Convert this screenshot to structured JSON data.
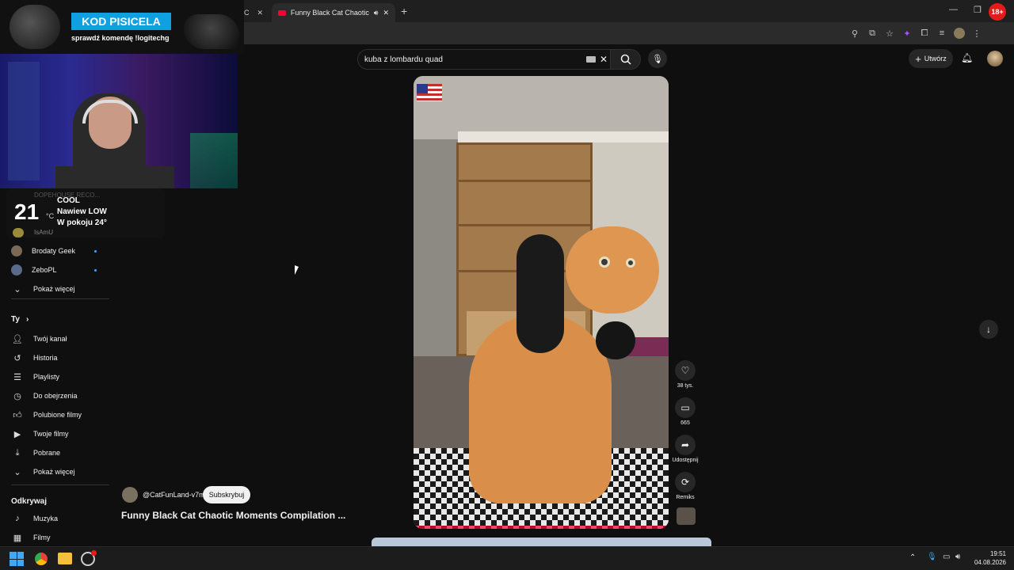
{
  "browser": {
    "tab_title": "Funny Black Cat Chaotic M",
    "tab_prev_fragment": "C",
    "new_tab": "+"
  },
  "overlay": {
    "banner_title": "KOD PISICELA",
    "banner_subtitle": "sprawdź komendę !logitechg",
    "age_badge": "18+",
    "temp": "21",
    "temp_unit": "°C",
    "weather_l1": "COOL",
    "weather_l2": "Nawiew LOW",
    "weather_l3": "W pokoju 24°",
    "faded_sub1": "DOPEHOUSE RECO...",
    "faded_sub2": "IsAmU"
  },
  "header": {
    "search_value": "kuba z lombardu quad",
    "create_label": "Utwórz"
  },
  "sidebar": {
    "subs": [
      {
        "label": "Brodaty Geek"
      },
      {
        "label": "ZeboPL"
      }
    ],
    "show_more_1": "Pokaż więcej",
    "you_title": "Ty",
    "you_items": [
      {
        "label": "Twój kanał",
        "icon": "person-icon"
      },
      {
        "label": "Historia",
        "icon": "history-icon"
      },
      {
        "label": "Playlisty",
        "icon": "playlist-icon"
      },
      {
        "label": "Do obejrzenia",
        "icon": "clock-icon"
      },
      {
        "label": "Polubione filmy",
        "icon": "like-icon"
      },
      {
        "label": "Twoje filmy",
        "icon": "play-icon"
      },
      {
        "label": "Pobrane",
        "icon": "download-icon"
      }
    ],
    "show_more_2": "Pokaż więcej",
    "discover_title": "Odkrywaj",
    "discover_items": [
      {
        "label": "Muzyka",
        "icon": "music-icon"
      },
      {
        "label": "Filmy",
        "icon": "film-icon"
      }
    ]
  },
  "short": {
    "channel": "@CatFunLand-v7m",
    "subscribe": "Subskrybuj",
    "title": "Funny Black Cat Chaotic Moments Compilation ...",
    "likes": "38 tys.",
    "comments": "665",
    "share": "Udostępnij",
    "remix": "Remiks"
  },
  "taskbar": {
    "time": "19:51",
    "date": "04.08.2026"
  },
  "colors": {
    "accent": "#3ea6ff",
    "banner": "#0ea0e0",
    "youtube_red": "#ff0033"
  }
}
